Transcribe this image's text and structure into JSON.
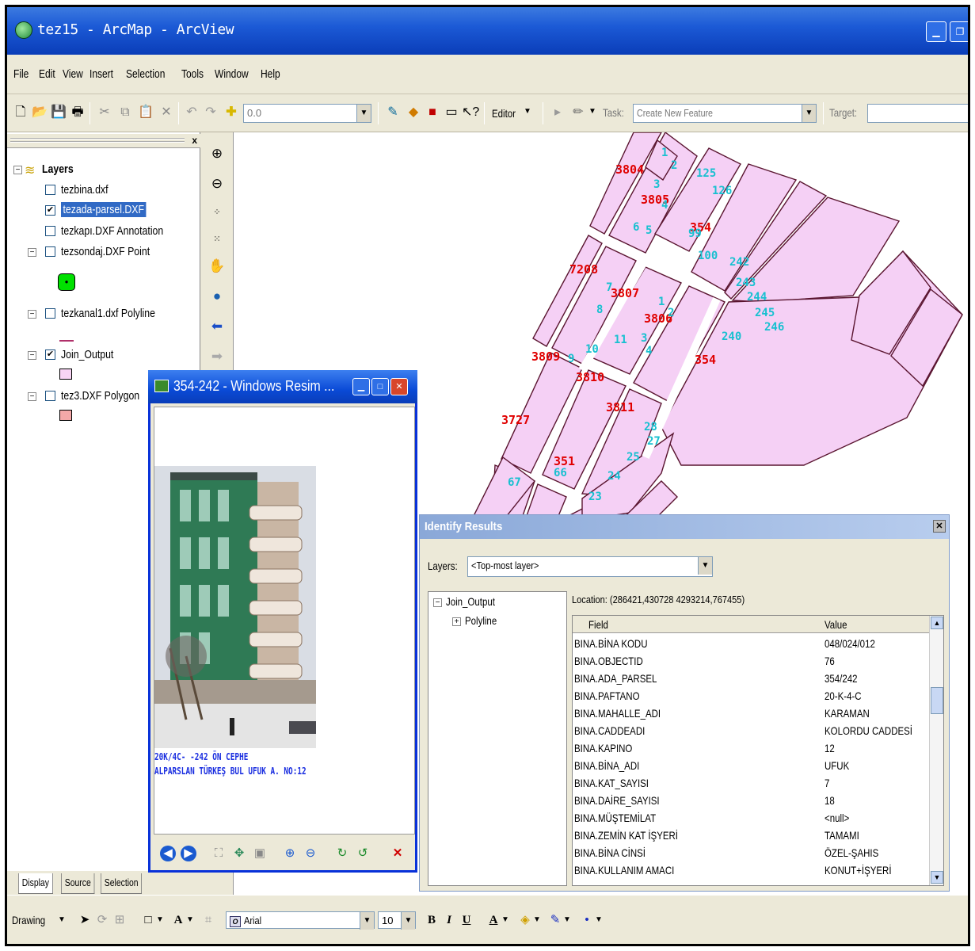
{
  "window": {
    "title": "tez15 - ArcMap - ArcView"
  },
  "menu": [
    "File",
    "Edit",
    "View",
    "Insert",
    "Selection",
    "Tools",
    "Window",
    "Help"
  ],
  "toolbar": {
    "scale_value": "0.0",
    "editor_label": "Editor",
    "task_label": "Task:",
    "task_value": "Create New Feature",
    "target_label": "Target:"
  },
  "toc": {
    "root": "Layers",
    "layers": [
      {
        "name": "tezbina.dxf",
        "checked": false
      },
      {
        "name": "tezada-parsel.DXF",
        "checked": true
      },
      {
        "name": "tezkapı.DXF Annotation",
        "checked": false
      },
      {
        "name": "tezsondaj.DXF Point",
        "checked": false
      },
      {
        "name": "tezkanal1.dxf Polyline",
        "checked": false
      },
      {
        "name": "Join_Output",
        "checked": true
      },
      {
        "name": "tez3.DXF Polygon",
        "checked": false
      }
    ],
    "tabs": [
      "Display",
      "Source",
      "Selection"
    ]
  },
  "map": {
    "red_labels": [
      "3804",
      "3805",
      "354",
      "7208",
      "3807",
      "3806",
      "3809",
      "3810",
      "3811",
      "354",
      "351",
      "3727"
    ],
    "cyan_labels": [
      "1",
      "2",
      "3",
      "4",
      "5",
      "6",
      "7",
      "8",
      "9",
      "10",
      "11",
      "125",
      "126",
      "99",
      "100",
      "242",
      "243",
      "244",
      "245",
      "246",
      "240",
      "28",
      "27",
      "25",
      "24",
      "23",
      "66",
      "67",
      "3",
      "4",
      "1",
      "2"
    ]
  },
  "viewer": {
    "title": "354-242 - Windows Resim ...",
    "caption_line1": "20K/4C-   -242 ÖN CEPHE",
    "caption_line2": "ALPARSLAN TÜRKEŞ BUL UFUK A. NO:12"
  },
  "identify": {
    "title": "Identify Results",
    "layers_label": "Layers:",
    "layers_value": "<Top-most layer>",
    "tree_root": "Join_Output",
    "tree_child": "Polyline",
    "location": "Location: (286421,430728 4293214,767455)",
    "col_field": "Field",
    "col_value": "Value",
    "rows": [
      {
        "field": "BINA.BİNA KODU",
        "value": "048/024/012"
      },
      {
        "field": "BINA.OBJECTID",
        "value": "76"
      },
      {
        "field": "BINA.ADA_PARSEL",
        "value": "354/242"
      },
      {
        "field": "BINA.PAFTANO",
        "value": "20-K-4-C"
      },
      {
        "field": "BINA.MAHALLE_ADI",
        "value": "KARAMAN"
      },
      {
        "field": "BINA.CADDEADI",
        "value": "KOLORDU CADDESİ"
      },
      {
        "field": "BINA.KAPINO",
        "value": "12"
      },
      {
        "field": "BINA.BİNA_ADI",
        "value": "UFUK"
      },
      {
        "field": "BINA.KAT_SAYISI",
        "value": "7"
      },
      {
        "field": "BINA.DAİRE_SAYISI",
        "value": "18"
      },
      {
        "field": "BINA.MÜŞTEMİLAT",
        "value": "<null>"
      },
      {
        "field": "BINA.ZEMİN KAT İŞYERİ",
        "value": "TAMAMI"
      },
      {
        "field": "BINA.BİNA CİNSİ",
        "value": "ÖZEL-ŞAHIS"
      },
      {
        "field": "BINA.KULLANIM AMACI",
        "value": "KONUT+İŞYERİ"
      }
    ]
  },
  "drawing": {
    "label": "Drawing",
    "font": "Arial",
    "size": "10",
    "bold": "B",
    "italic": "I",
    "underline": "U",
    "font_color": "A"
  },
  "colors": {
    "parcel_fill": "#f5d0f5",
    "parcel_stroke": "#5a1530",
    "label_red": "#e00000",
    "label_cyan": "#18c0d0",
    "title_blue": "#0a3db8"
  }
}
